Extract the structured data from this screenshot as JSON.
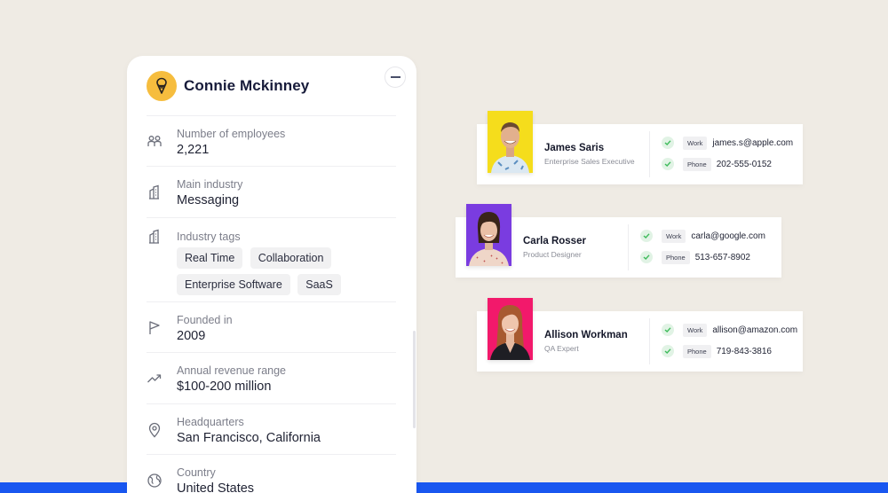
{
  "company": {
    "name": "Connie Mckinney",
    "fields": [
      {
        "label": "Number of employees",
        "value": "2,221",
        "icon": "people-icon"
      },
      {
        "label": "Main industry",
        "value": "Messaging",
        "icon": "building-icon"
      },
      {
        "label": "Industry tags",
        "icon": "building-icon",
        "tags": [
          "Real Time",
          "Collaboration",
          "Enterprise Software",
          "SaaS"
        ]
      },
      {
        "label": "Founded in",
        "value": "2009",
        "icon": "flag-icon"
      },
      {
        "label": "Annual revenue range",
        "value": "$100-200 million",
        "icon": "trend-up-icon"
      },
      {
        "label": "Headquarters",
        "value": "San Francisco, California",
        "icon": "location-pin-icon"
      },
      {
        "label": "Country",
        "value": "United States",
        "icon": "globe-icon"
      }
    ]
  },
  "contacts": [
    {
      "name": "James Saris",
      "title": "Enterprise Sales Executive",
      "photo_bg": "#f5dd1c",
      "shirt": "#dbe8f2",
      "lines": [
        {
          "chip": "Work",
          "value": "james.s@apple.com"
        },
        {
          "chip": "Phone",
          "value": "202-555-0152"
        }
      ]
    },
    {
      "name": "Carla Rosser",
      "title": "Product Designer",
      "photo_bg": "#7a3ce0",
      "shirt": "#efd6c8",
      "lines": [
        {
          "chip": "Work",
          "value": "carla@google.com"
        },
        {
          "chip": "Phone",
          "value": "513-657-8902"
        }
      ]
    },
    {
      "name": "Allison Workman",
      "title": "QA Expert",
      "photo_bg": "#f2196b",
      "shirt": "#1e1e24",
      "lines": [
        {
          "chip": "Work",
          "value": "allison@amazon.com"
        },
        {
          "chip": "Phone",
          "value": "719-843-3816"
        }
      ]
    }
  ],
  "colors": {
    "background": "#efebe4",
    "accent_bar": "#1957f0",
    "logo": "#f6bd3e",
    "check": "#3dbb5a"
  }
}
